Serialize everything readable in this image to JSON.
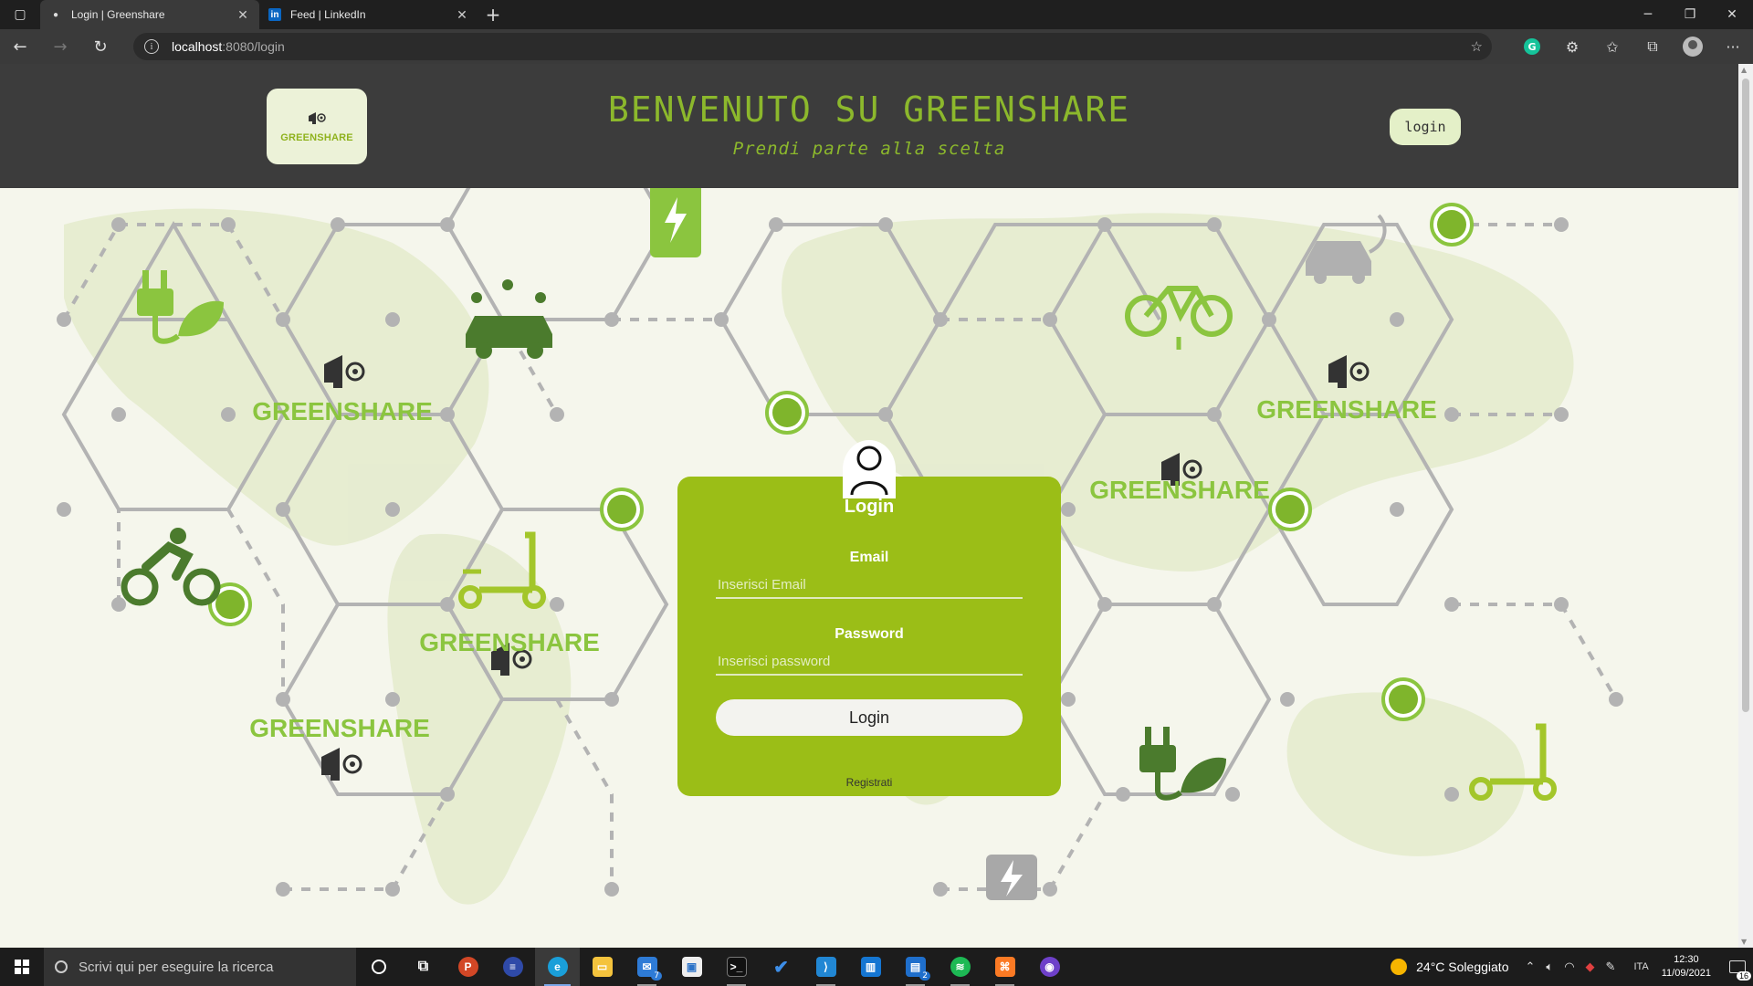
{
  "browser": {
    "tabs": [
      {
        "title": "Login | Greenshare",
        "active": true
      },
      {
        "title": "Feed | LinkedIn",
        "active": false
      }
    ],
    "url_host": "localhost",
    "url_path": ":8080/login"
  },
  "site": {
    "logo_text": "GREENSHARE",
    "title": "BENVENUTO SU GREENSHARE",
    "subtitle": "Prendi parte alla scelta",
    "header_login": "login",
    "bg_brand": "GREENSHARE"
  },
  "login": {
    "title": "Login",
    "email_label": "Email",
    "email_placeholder": "Inserisci Email",
    "email_value": "",
    "password_label": "Password",
    "password_placeholder": "Inserisci password",
    "password_value": "",
    "button": "Login",
    "register": "Registrati"
  },
  "taskbar": {
    "search_placeholder": "Scrivi qui per eseguire la ricerca",
    "mail_badge": "7",
    "notes_badge": "2",
    "weather": "24°C  Soleggiato",
    "lang": "ITA",
    "time": "12:30",
    "date": "11/09/2021",
    "notif_count": "16"
  },
  "colors": {
    "brand_green": "#9bbe17",
    "header_bg": "#3c3c3c",
    "title_green": "#8cb82c"
  }
}
